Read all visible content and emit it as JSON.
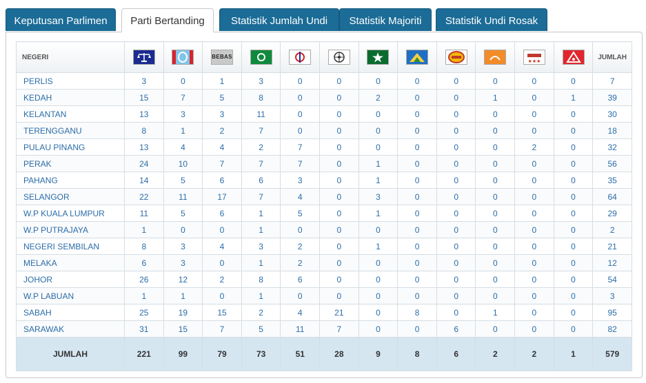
{
  "tabs": [
    {
      "label": "Keputusan Parlimen",
      "active": false
    },
    {
      "label": "Parti Bertanding",
      "active": true
    },
    {
      "label": "Statistik Jumlah Undi",
      "active": false
    },
    {
      "label": "Statistik Majoriti",
      "active": false
    },
    {
      "label": "Statistik Undi Rosak",
      "active": false
    }
  ],
  "table": {
    "first_header": "NEGERI",
    "last_header": "JUMLAH",
    "parties": [
      {
        "icon": "bn-scales-logo-icon"
      },
      {
        "icon": "pkr-logo-icon"
      },
      {
        "icon": "bebas-logo-icon",
        "text": "BEBAS"
      },
      {
        "icon": "pas-logo-icon"
      },
      {
        "icon": "dap-logo-icon"
      },
      {
        "icon": "party-wheel-logo-icon"
      },
      {
        "icon": "party-star-logo-icon"
      },
      {
        "icon": "party-mountain-logo-icon"
      },
      {
        "icon": "party-oval-logo-icon"
      },
      {
        "icon": "party-orange-logo-icon"
      },
      {
        "icon": "party-stars-logo-icon"
      },
      {
        "icon": "party-red-logo-icon"
      }
    ],
    "rows": [
      {
        "state": "PERLIS",
        "values": [
          3,
          0,
          1,
          3,
          0,
          0,
          0,
          0,
          0,
          0,
          0,
          0
        ],
        "total": 7
      },
      {
        "state": "KEDAH",
        "values": [
          15,
          7,
          5,
          8,
          0,
          0,
          2,
          0,
          0,
          1,
          0,
          1
        ],
        "total": 39
      },
      {
        "state": "KELANTAN",
        "values": [
          13,
          3,
          3,
          11,
          0,
          0,
          0,
          0,
          0,
          0,
          0,
          0
        ],
        "total": 30
      },
      {
        "state": "TERENGGANU",
        "values": [
          8,
          1,
          2,
          7,
          0,
          0,
          0,
          0,
          0,
          0,
          0,
          0
        ],
        "total": 18
      },
      {
        "state": "PULAU PINANG",
        "values": [
          13,
          4,
          4,
          2,
          7,
          0,
          0,
          0,
          0,
          0,
          2,
          0
        ],
        "total": 32
      },
      {
        "state": "PERAK",
        "values": [
          24,
          10,
          7,
          7,
          7,
          0,
          1,
          0,
          0,
          0,
          0,
          0
        ],
        "total": 56
      },
      {
        "state": "PAHANG",
        "values": [
          14,
          5,
          6,
          6,
          3,
          0,
          1,
          0,
          0,
          0,
          0,
          0
        ],
        "total": 35
      },
      {
        "state": "SELANGOR",
        "values": [
          22,
          11,
          17,
          7,
          4,
          0,
          3,
          0,
          0,
          0,
          0,
          0
        ],
        "total": 64
      },
      {
        "state": "W.P KUALA LUMPUR",
        "values": [
          11,
          5,
          6,
          1,
          5,
          0,
          1,
          0,
          0,
          0,
          0,
          0
        ],
        "total": 29
      },
      {
        "state": "W.P PUTRAJAYA",
        "values": [
          1,
          0,
          0,
          1,
          0,
          0,
          0,
          0,
          0,
          0,
          0,
          0
        ],
        "total": 2
      },
      {
        "state": "NEGERI SEMBILAN",
        "values": [
          8,
          3,
          4,
          3,
          2,
          0,
          1,
          0,
          0,
          0,
          0,
          0
        ],
        "total": 21
      },
      {
        "state": "MELAKA",
        "values": [
          6,
          3,
          0,
          1,
          2,
          0,
          0,
          0,
          0,
          0,
          0,
          0
        ],
        "total": 12
      },
      {
        "state": "JOHOR",
        "values": [
          26,
          12,
          2,
          8,
          6,
          0,
          0,
          0,
          0,
          0,
          0,
          0
        ],
        "total": 54
      },
      {
        "state": "W.P LABUAN",
        "values": [
          1,
          1,
          0,
          1,
          0,
          0,
          0,
          0,
          0,
          0,
          0,
          0
        ],
        "total": 3
      },
      {
        "state": "SABAH",
        "values": [
          25,
          19,
          15,
          2,
          4,
          21,
          0,
          8,
          0,
          1,
          0,
          0
        ],
        "total": 95
      },
      {
        "state": "SARAWAK",
        "values": [
          31,
          15,
          7,
          5,
          11,
          7,
          0,
          0,
          6,
          0,
          0,
          0
        ],
        "total": 82
      }
    ],
    "footer": {
      "label": "JUMLAH",
      "values": [
        221,
        99,
        79,
        73,
        51,
        28,
        9,
        8,
        6,
        2,
        2,
        1
      ],
      "total": 579
    }
  },
  "colors": {
    "tab_bg": "#1b6c96",
    "link_text": "#2b6da8",
    "footer_bg": "#d5e6f1"
  }
}
